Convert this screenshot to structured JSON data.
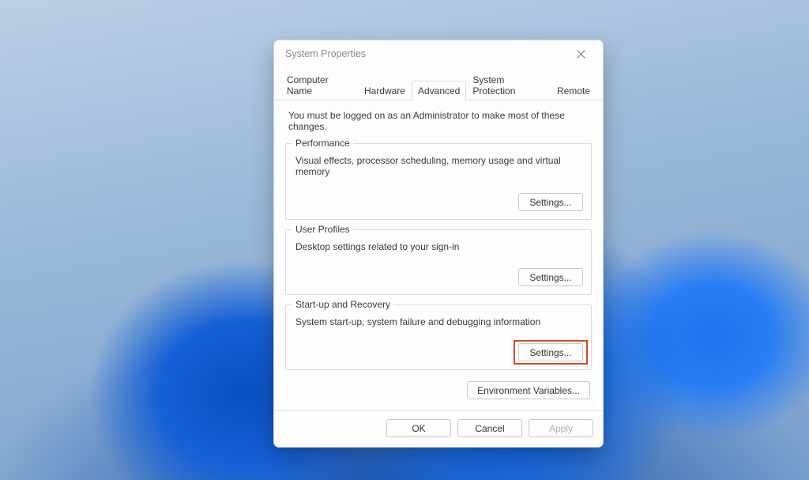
{
  "window": {
    "title": "System Properties"
  },
  "tabs": {
    "computer_name": "Computer Name",
    "hardware": "Hardware",
    "advanced": "Advanced",
    "system_protection": "System Protection",
    "remote": "Remote",
    "active": "advanced"
  },
  "advanced": {
    "admin_note": "You must be logged on as an Administrator to make most of these changes.",
    "performance": {
      "legend": "Performance",
      "desc": "Visual effects, processor scheduling, memory usage and virtual memory",
      "button": "Settings..."
    },
    "user_profiles": {
      "legend": "User Profiles",
      "desc": "Desktop settings related to your sign-in",
      "button": "Settings..."
    },
    "startup_recovery": {
      "legend": "Start-up and Recovery",
      "desc": "System start-up, system failure and debugging information",
      "button": "Settings..."
    },
    "env_button": "Environment Variables..."
  },
  "footer": {
    "ok": "OK",
    "cancel": "Cancel",
    "apply": "Apply"
  },
  "highlight": {
    "target": "startup-recovery-settings-button"
  }
}
